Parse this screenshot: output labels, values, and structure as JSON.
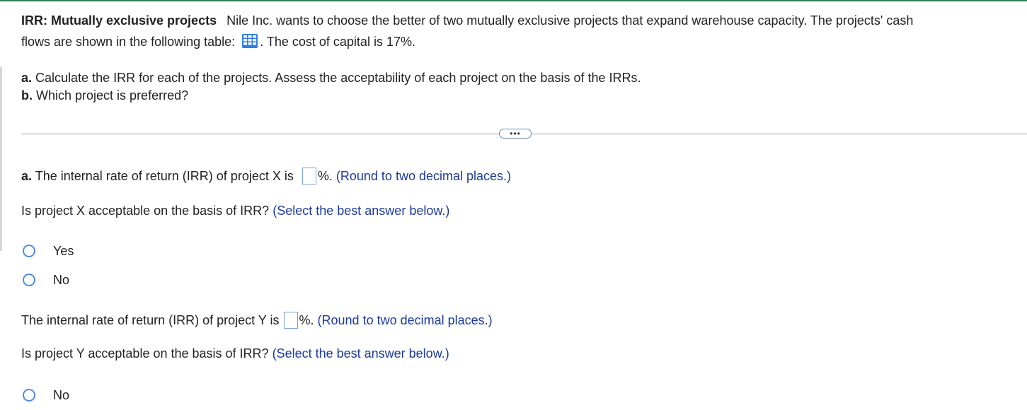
{
  "question": {
    "title": "IRR: Mutually exclusive projects",
    "text_line1": "Nile Inc. wants to choose the better of two mutually exclusive projects that  expand warehouse capacity.  The projects' cash",
    "text_line2_before": "flows are shown in the following table:",
    "table_icon": "table-grid-icon",
    "text_line2_after": ".  The cost of capital is 17%."
  },
  "parts": {
    "a_label": "a.",
    "a_text": "Calculate the IRR for each of the projects. Assess the acceptability of each project on the basis of the IRRs.",
    "b_label": "b.",
    "b_text": "Which project is preferred?"
  },
  "more_button": "•••",
  "answer": {
    "x_prefix_label": "a.",
    "x_irr_text": "The internal rate of return (IRR) of project X is",
    "x_irr_value": "",
    "x_suffix": "%.",
    "x_hint": "(Round to two decimal places.)",
    "x_accept_question": "Is project X acceptable on the basis of IRR?",
    "x_accept_hint": "(Select the best answer below.)",
    "x_options": [
      "Yes",
      "No"
    ],
    "y_irr_text": "The internal rate of return (IRR) of project Y is",
    "y_irr_value": "",
    "y_suffix": "%.",
    "y_hint": "(Round to two decimal places.)",
    "y_accept_question": "Is project Y acceptable on the basis of IRR?",
    "y_accept_hint": "(Select the best answer below.)",
    "y_options": [
      "No"
    ]
  },
  "colors": {
    "accent": "#2e7d5b",
    "hint": "#1a3a9e",
    "radio": "#4f8de0"
  }
}
